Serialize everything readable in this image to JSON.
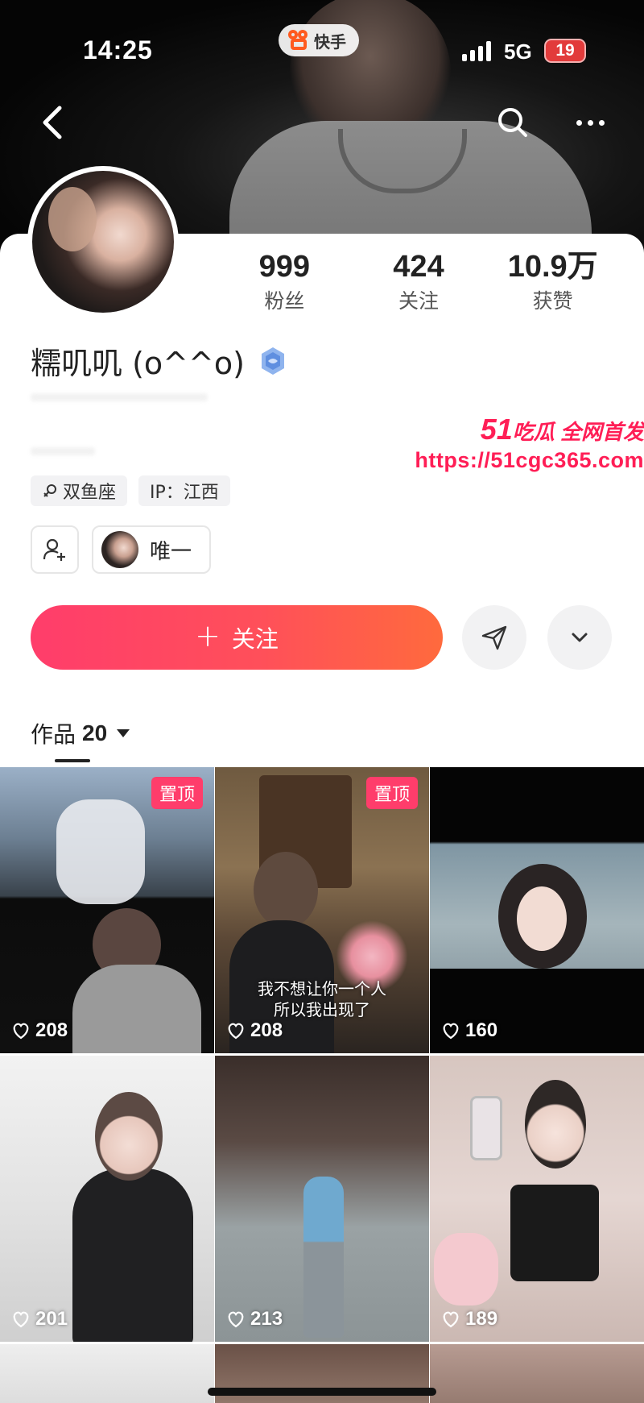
{
  "status_bar": {
    "time": "14:25",
    "network": "5G",
    "battery": "19"
  },
  "app": {
    "name": "快手"
  },
  "nav": {
    "back_icon": "chevron-left-icon",
    "search_icon": "search-icon",
    "more_icon": "more-horizontal-icon"
  },
  "profile": {
    "name": "糯叽叽 (o^^o)",
    "verify_icon": "verified-badge-icon",
    "stats": [
      {
        "value": "999",
        "label": "粉丝"
      },
      {
        "value": "424",
        "label": "关注"
      },
      {
        "value": "10.9万",
        "label": "获赞"
      }
    ],
    "tags": [
      {
        "icon": "zodiac-icon",
        "label": "双鱼座"
      },
      {
        "label": "IP：江西"
      }
    ],
    "linked_account": "唯一"
  },
  "actions": {
    "follow_label": "关注",
    "share_icon": "send-icon",
    "expand_icon": "chevron-down-icon"
  },
  "works_tab": {
    "label": "作品",
    "count": "20"
  },
  "works": [
    {
      "likes": "208",
      "pinned": "置顶"
    },
    {
      "likes": "208",
      "pinned": "置顶",
      "caption_line1": "我不想让你一个人",
      "caption_line2": "所以我出现了"
    },
    {
      "likes": "160"
    },
    {
      "likes": "201"
    },
    {
      "likes": "213"
    },
    {
      "likes": "189"
    }
  ],
  "watermark": {
    "brand_num": "51",
    "brand_text": "吃瓜 全网首发",
    "url": "https://51cgc365.com"
  },
  "colors": {
    "accent": "#ff3d6b",
    "accent_end": "#ff6a3d",
    "watermark": "#ff1e56"
  }
}
